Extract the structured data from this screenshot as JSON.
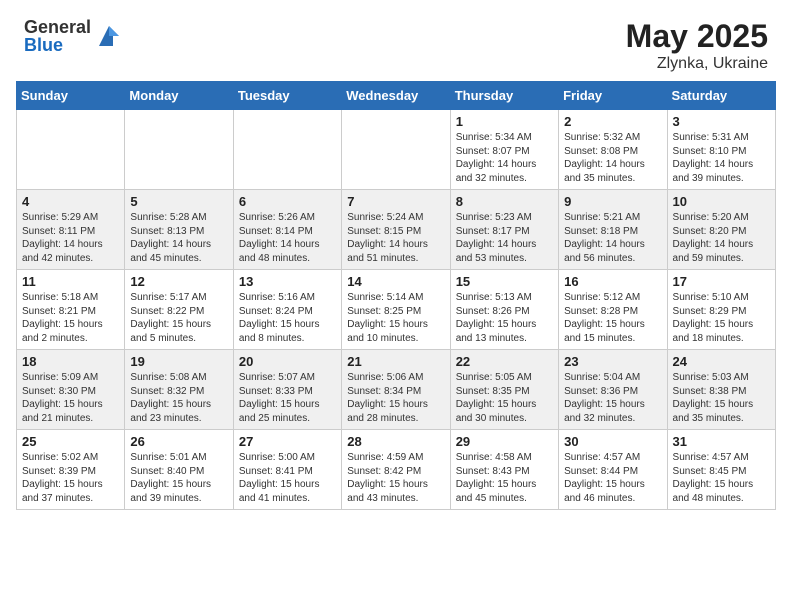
{
  "header": {
    "logo_general": "General",
    "logo_blue": "Blue",
    "month_year": "May 2025",
    "location": "Zlynka, Ukraine"
  },
  "weekdays": [
    "Sunday",
    "Monday",
    "Tuesday",
    "Wednesday",
    "Thursday",
    "Friday",
    "Saturday"
  ],
  "weeks": [
    [
      {
        "day": "",
        "info": ""
      },
      {
        "day": "",
        "info": ""
      },
      {
        "day": "",
        "info": ""
      },
      {
        "day": "",
        "info": ""
      },
      {
        "day": "1",
        "info": "Sunrise: 5:34 AM\nSunset: 8:07 PM\nDaylight: 14 hours\nand 32 minutes."
      },
      {
        "day": "2",
        "info": "Sunrise: 5:32 AM\nSunset: 8:08 PM\nDaylight: 14 hours\nand 35 minutes."
      },
      {
        "day": "3",
        "info": "Sunrise: 5:31 AM\nSunset: 8:10 PM\nDaylight: 14 hours\nand 39 minutes."
      }
    ],
    [
      {
        "day": "4",
        "info": "Sunrise: 5:29 AM\nSunset: 8:11 PM\nDaylight: 14 hours\nand 42 minutes."
      },
      {
        "day": "5",
        "info": "Sunrise: 5:28 AM\nSunset: 8:13 PM\nDaylight: 14 hours\nand 45 minutes."
      },
      {
        "day": "6",
        "info": "Sunrise: 5:26 AM\nSunset: 8:14 PM\nDaylight: 14 hours\nand 48 minutes."
      },
      {
        "day": "7",
        "info": "Sunrise: 5:24 AM\nSunset: 8:15 PM\nDaylight: 14 hours\nand 51 minutes."
      },
      {
        "day": "8",
        "info": "Sunrise: 5:23 AM\nSunset: 8:17 PM\nDaylight: 14 hours\nand 53 minutes."
      },
      {
        "day": "9",
        "info": "Sunrise: 5:21 AM\nSunset: 8:18 PM\nDaylight: 14 hours\nand 56 minutes."
      },
      {
        "day": "10",
        "info": "Sunrise: 5:20 AM\nSunset: 8:20 PM\nDaylight: 14 hours\nand 59 minutes."
      }
    ],
    [
      {
        "day": "11",
        "info": "Sunrise: 5:18 AM\nSunset: 8:21 PM\nDaylight: 15 hours\nand 2 minutes."
      },
      {
        "day": "12",
        "info": "Sunrise: 5:17 AM\nSunset: 8:22 PM\nDaylight: 15 hours\nand 5 minutes."
      },
      {
        "day": "13",
        "info": "Sunrise: 5:16 AM\nSunset: 8:24 PM\nDaylight: 15 hours\nand 8 minutes."
      },
      {
        "day": "14",
        "info": "Sunrise: 5:14 AM\nSunset: 8:25 PM\nDaylight: 15 hours\nand 10 minutes."
      },
      {
        "day": "15",
        "info": "Sunrise: 5:13 AM\nSunset: 8:26 PM\nDaylight: 15 hours\nand 13 minutes."
      },
      {
        "day": "16",
        "info": "Sunrise: 5:12 AM\nSunset: 8:28 PM\nDaylight: 15 hours\nand 15 minutes."
      },
      {
        "day": "17",
        "info": "Sunrise: 5:10 AM\nSunset: 8:29 PM\nDaylight: 15 hours\nand 18 minutes."
      }
    ],
    [
      {
        "day": "18",
        "info": "Sunrise: 5:09 AM\nSunset: 8:30 PM\nDaylight: 15 hours\nand 21 minutes."
      },
      {
        "day": "19",
        "info": "Sunrise: 5:08 AM\nSunset: 8:32 PM\nDaylight: 15 hours\nand 23 minutes."
      },
      {
        "day": "20",
        "info": "Sunrise: 5:07 AM\nSunset: 8:33 PM\nDaylight: 15 hours\nand 25 minutes."
      },
      {
        "day": "21",
        "info": "Sunrise: 5:06 AM\nSunset: 8:34 PM\nDaylight: 15 hours\nand 28 minutes."
      },
      {
        "day": "22",
        "info": "Sunrise: 5:05 AM\nSunset: 8:35 PM\nDaylight: 15 hours\nand 30 minutes."
      },
      {
        "day": "23",
        "info": "Sunrise: 5:04 AM\nSunset: 8:36 PM\nDaylight: 15 hours\nand 32 minutes."
      },
      {
        "day": "24",
        "info": "Sunrise: 5:03 AM\nSunset: 8:38 PM\nDaylight: 15 hours\nand 35 minutes."
      }
    ],
    [
      {
        "day": "25",
        "info": "Sunrise: 5:02 AM\nSunset: 8:39 PM\nDaylight: 15 hours\nand 37 minutes."
      },
      {
        "day": "26",
        "info": "Sunrise: 5:01 AM\nSunset: 8:40 PM\nDaylight: 15 hours\nand 39 minutes."
      },
      {
        "day": "27",
        "info": "Sunrise: 5:00 AM\nSunset: 8:41 PM\nDaylight: 15 hours\nand 41 minutes."
      },
      {
        "day": "28",
        "info": "Sunrise: 4:59 AM\nSunset: 8:42 PM\nDaylight: 15 hours\nand 43 minutes."
      },
      {
        "day": "29",
        "info": "Sunrise: 4:58 AM\nSunset: 8:43 PM\nDaylight: 15 hours\nand 45 minutes."
      },
      {
        "day": "30",
        "info": "Sunrise: 4:57 AM\nSunset: 8:44 PM\nDaylight: 15 hours\nand 46 minutes."
      },
      {
        "day": "31",
        "info": "Sunrise: 4:57 AM\nSunset: 8:45 PM\nDaylight: 15 hours\nand 48 minutes."
      }
    ]
  ]
}
